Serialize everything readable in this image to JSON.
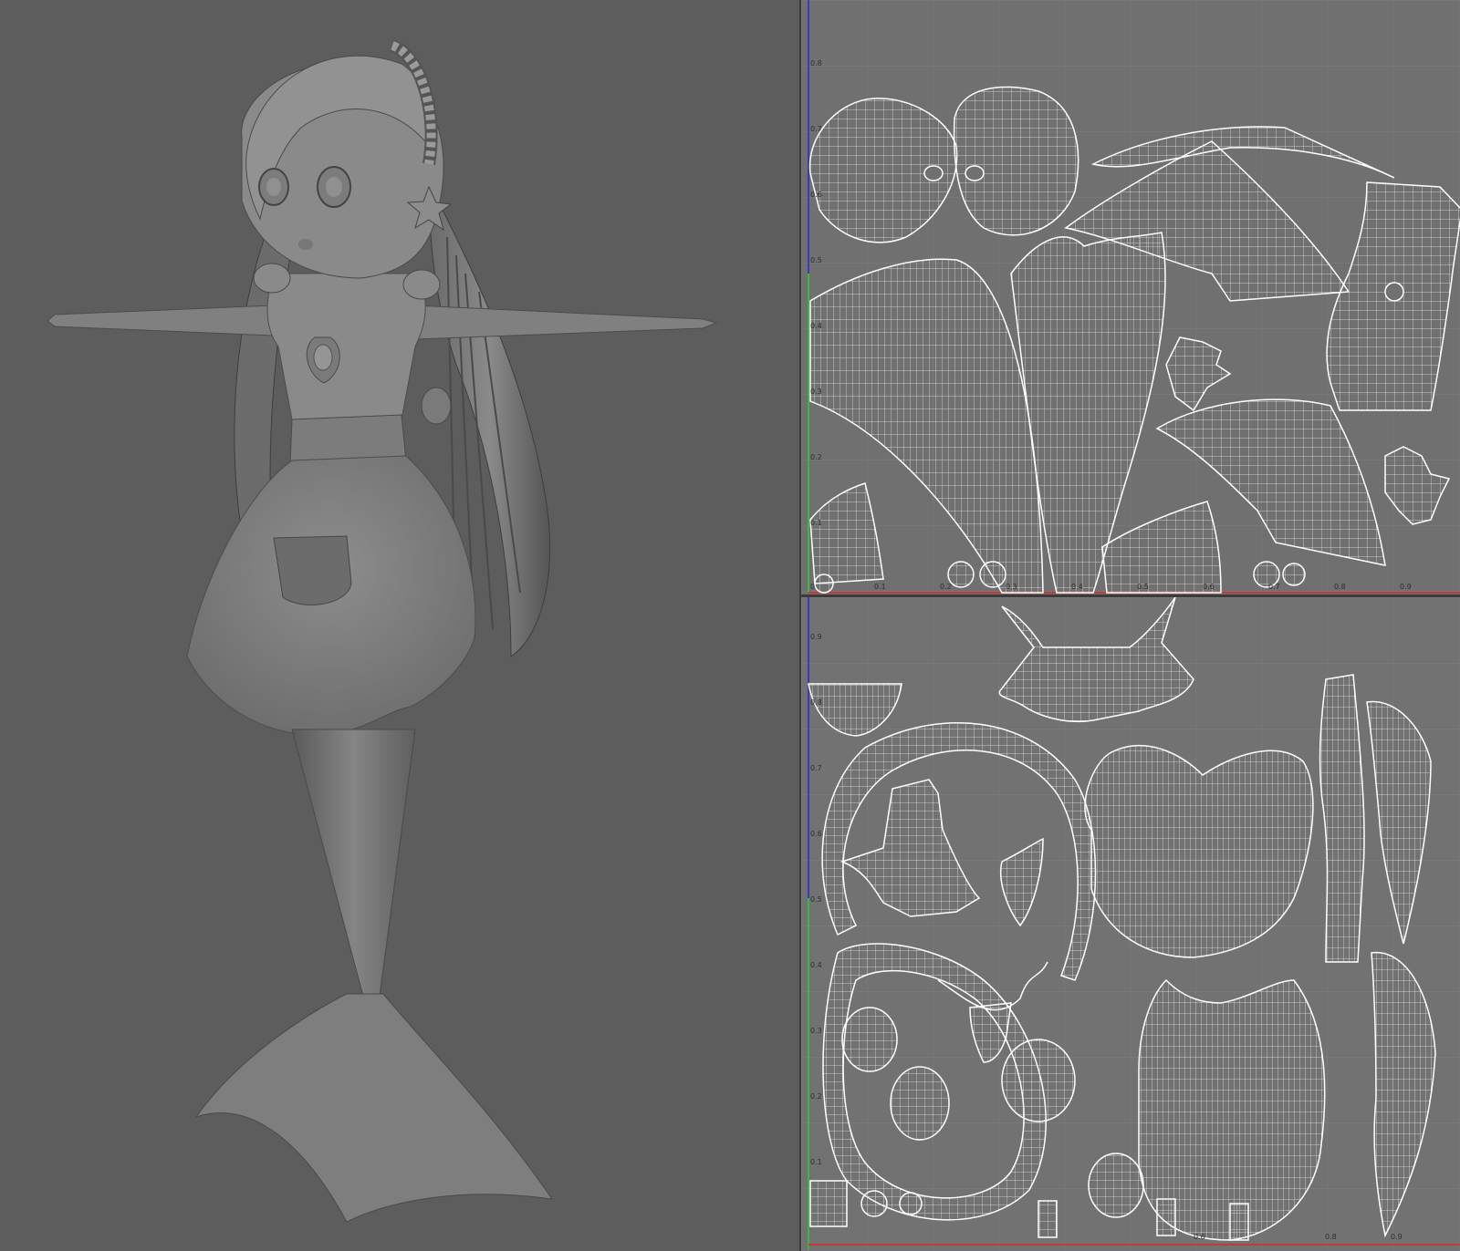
{
  "viewport_3d": {
    "label": "3D perspective viewport",
    "subject": "mermaid character model"
  },
  "uv_editor_top": {
    "v_ticks": [
      "0.8",
      "0.7",
      "0.6",
      "0.5",
      "0.4",
      "0.3",
      "0.2",
      "0.1",
      "0"
    ],
    "u_ticks": [
      "0.1",
      "0.2",
      "0.3",
      "0.4",
      "0.5",
      "0.6",
      "0.7",
      "0.8",
      "0.9"
    ]
  },
  "uv_editor_bottom": {
    "v_ticks": [
      "0.9",
      "0.8",
      "0.7",
      "0.6",
      "0.5",
      "0.4",
      "0.3",
      "0.2",
      "0.1"
    ],
    "u_ticks": [
      "0.6",
      "0.8",
      "0.9"
    ]
  },
  "colors": {
    "background": "#5d5d5d",
    "uv_background": "#707070",
    "wire": "#ffffff",
    "grid": "#7c7c7c",
    "axis_u": "#c23b3b",
    "axis_v": "#3a3ab8",
    "axis_green": "#3ab83a"
  }
}
